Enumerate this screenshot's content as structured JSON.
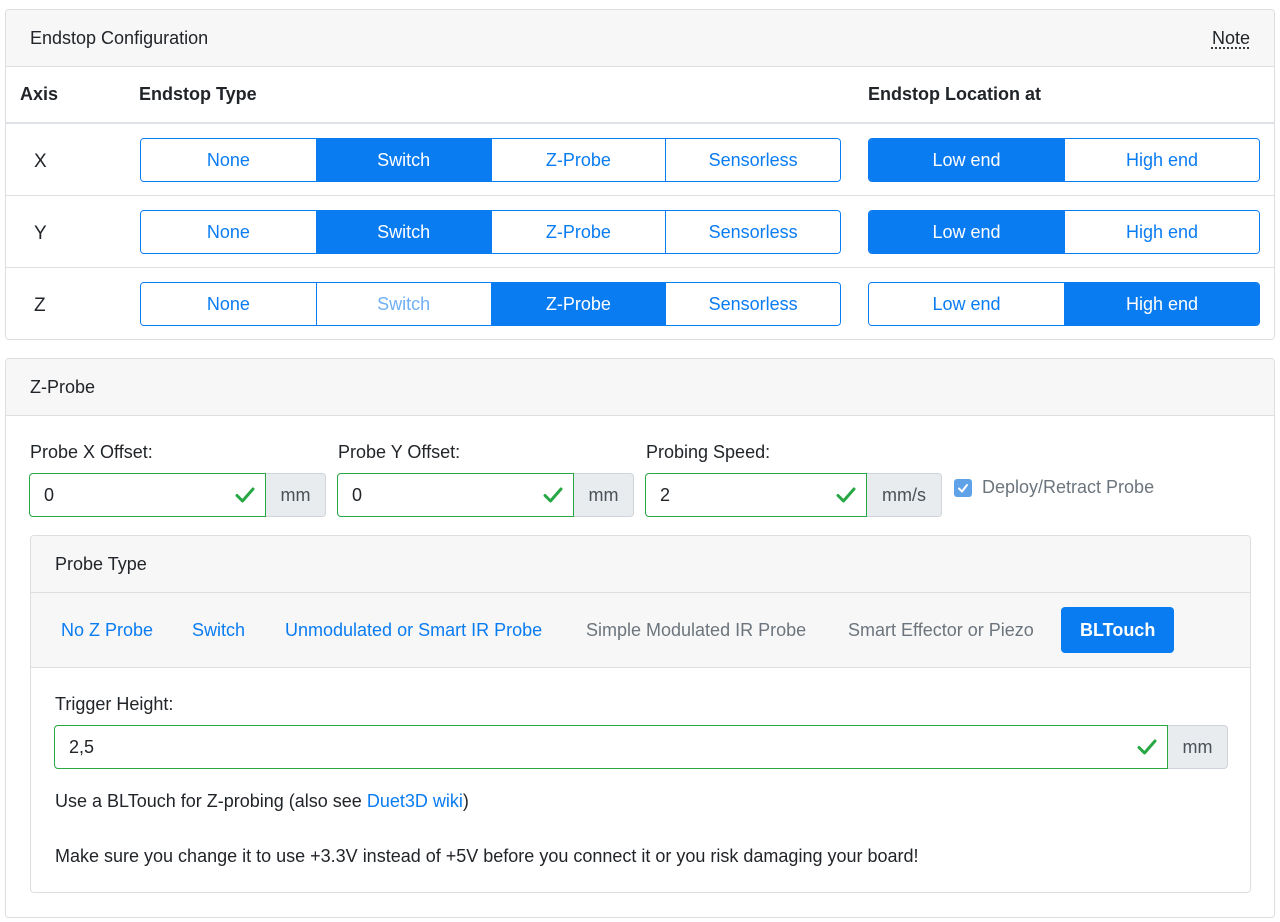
{
  "endstop": {
    "title": "Endstop Configuration",
    "note": "Note",
    "headers": {
      "axis": "Axis",
      "type": "Endstop Type",
      "location": "Endstop Location at"
    },
    "type_options": [
      "None",
      "Switch",
      "Z-Probe",
      "Sensorless"
    ],
    "location_options": [
      "Low end",
      "High end"
    ],
    "rows": [
      {
        "axis": "X",
        "type": "Switch",
        "location": "Low end",
        "switch_disabled": false
      },
      {
        "axis": "Y",
        "type": "Switch",
        "location": "Low end",
        "switch_disabled": false
      },
      {
        "axis": "Z",
        "type": "Z-Probe",
        "location": "High end",
        "switch_disabled": true
      }
    ]
  },
  "zprobe": {
    "title": "Z-Probe",
    "x_offset": {
      "label": "Probe X Offset:",
      "value": "0",
      "unit": "mm"
    },
    "y_offset": {
      "label": "Probe Y Offset:",
      "value": "0",
      "unit": "mm"
    },
    "speed": {
      "label": "Probing Speed:",
      "value": "2",
      "unit": "mm/s"
    },
    "deploy": {
      "label": "Deploy/Retract Probe",
      "checked": true
    },
    "probe_type": {
      "title": "Probe Type",
      "options": [
        {
          "label": "No Z Probe",
          "state": "link"
        },
        {
          "label": "Switch",
          "state": "link"
        },
        {
          "label": "Unmodulated or Smart IR Probe",
          "state": "link"
        },
        {
          "label": "Simple Modulated IR Probe",
          "state": "muted"
        },
        {
          "label": "Smart Effector or Piezo",
          "state": "muted"
        },
        {
          "label": "BLTouch",
          "state": "active"
        }
      ]
    },
    "trigger": {
      "label": "Trigger Height:",
      "value": "2,5",
      "unit": "mm"
    },
    "info_prefix": "Use a BLTouch for Z-probing (also see ",
    "info_link": "Duet3D wiki",
    "info_suffix": ")",
    "warning": "Make sure you change it to use +3.3V instead of +5V before you connect it or you risk damaging your board!"
  },
  "colors": {
    "primary": "#0a7cf2",
    "valid": "#28a745",
    "muted": "#6c757d"
  }
}
